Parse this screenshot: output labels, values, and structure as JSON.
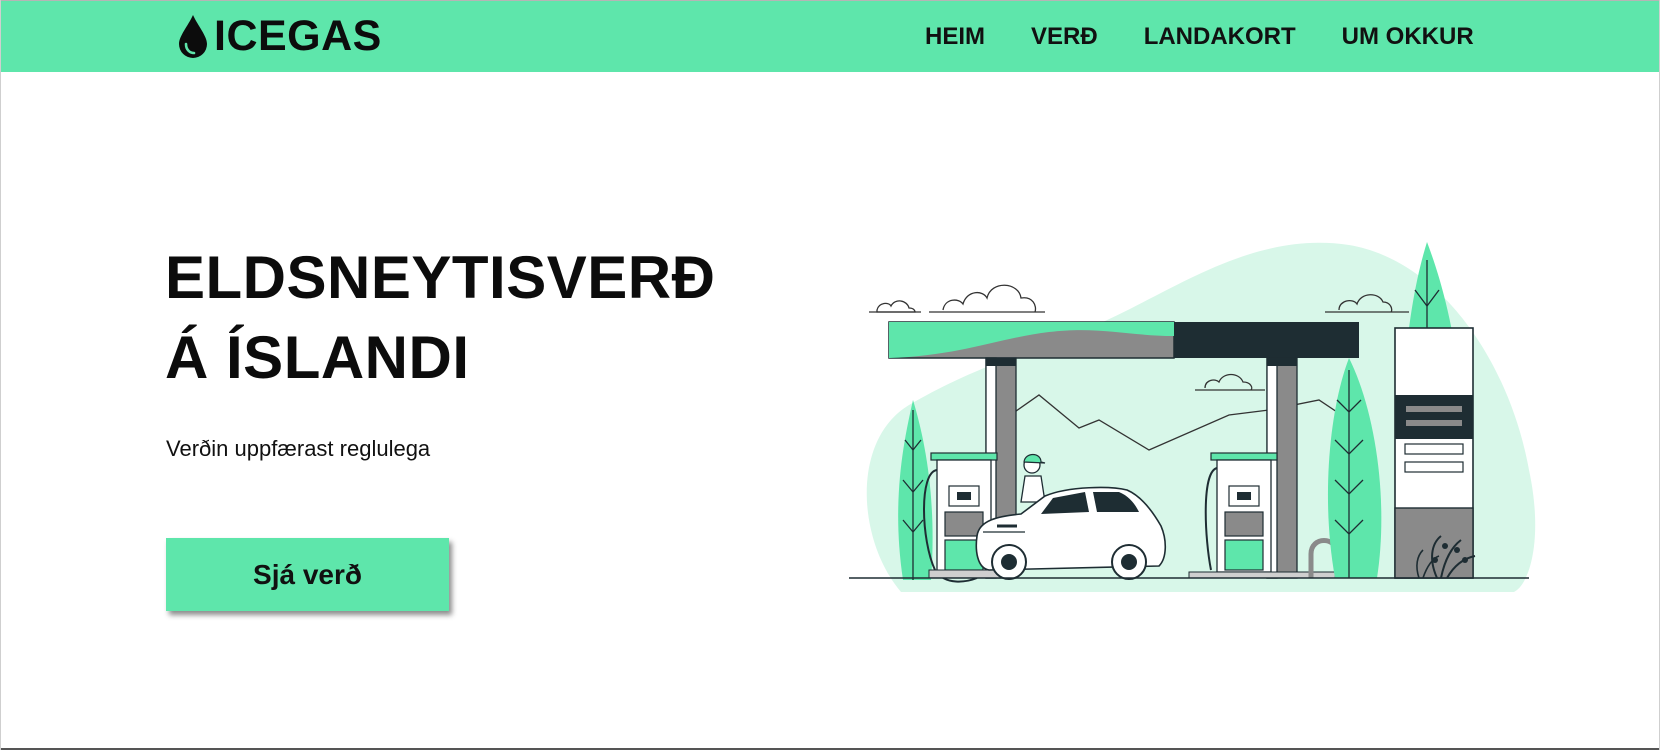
{
  "header": {
    "logo_text": "ICEGAS",
    "logo_icon": "drop-icon",
    "nav": [
      {
        "label": "HEIM"
      },
      {
        "label": "VERÐ"
      },
      {
        "label": "LANDAKORT"
      },
      {
        "label": "UM OKKUR"
      }
    ]
  },
  "hero": {
    "title_line1": "ELDSNEYTISVERÐ",
    "title_line2": "Á ÍSLANDI",
    "subtitle": "Verðin uppfærast reglulega",
    "cta_label": "Sjá verð"
  },
  "illustration": {
    "name": "gas-station-illustration"
  },
  "colors": {
    "accent": "#5ee6ab",
    "accent_light": "#d8f7e9",
    "dark": "#1e2d33",
    "gray": "#8a8a8a",
    "text": "#111111"
  }
}
